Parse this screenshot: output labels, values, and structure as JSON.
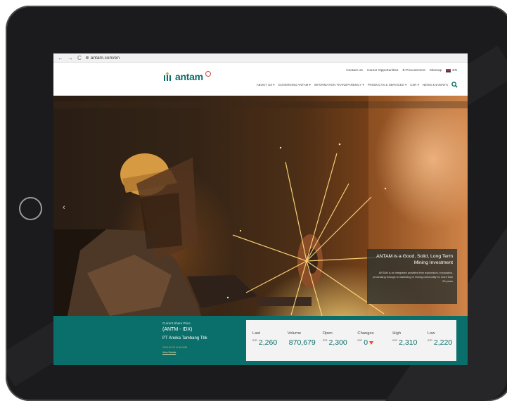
{
  "browser": {
    "back_glyph": "←",
    "forward_glyph": "→",
    "reload_glyph": "C",
    "url": "antam.com/en"
  },
  "header": {
    "logo_text": "antam",
    "top_links": [
      "Contact Us",
      "Career Opportunities",
      "E-Procurement",
      "Sitemap"
    ],
    "language": "EN",
    "nav_items": [
      "ABOUT US",
      "GOVERNING ANTAM",
      "INFORMATION TRANSPARENCY",
      "PRODUCTS & SERVICES",
      "CSR",
      "NEWS & EVENTS"
    ],
    "dropdown_glyph": "▾"
  },
  "hero": {
    "prev_glyph": "‹",
    "card_title": "ANTAM is a Good, Solid, Long Term Mining Investment",
    "card_body": "ANTAM is an integrated activities from exploration, excavation, processing through to marketing of mining commodity for more than 50 years"
  },
  "stock": {
    "heading": "Current Share Price",
    "code": "(ANTM - IDX)",
    "company": "PT Aneka Tambang Tbk",
    "date": "2018-02-22 11:48 WIB",
    "more": "View Details",
    "stats": [
      {
        "label": "Last",
        "unit": "IDR",
        "value": "2,260"
      },
      {
        "label": "Volume",
        "unit": "",
        "value": "870,679"
      },
      {
        "label": "Open",
        "unit": "IDR",
        "value": "2,300"
      },
      {
        "label": "Changes",
        "unit": "IDR",
        "value": "0"
      },
      {
        "label": "High",
        "unit": "IDR",
        "value": "2,310"
      },
      {
        "label": "Low",
        "unit": "IDR",
        "value": "2,220"
      }
    ]
  },
  "colors": {
    "brand_teal": "#0a6f6a",
    "accent_red": "#e34c2d",
    "logo_orange": "#d24a36"
  }
}
